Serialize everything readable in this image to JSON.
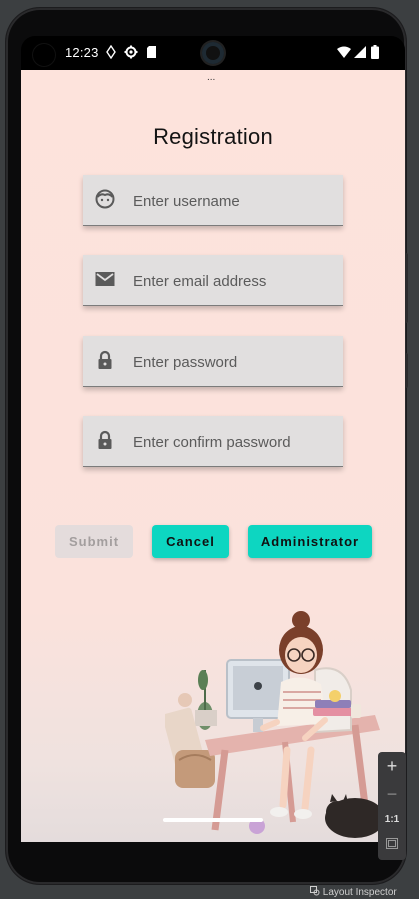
{
  "status_bar": {
    "time": "12:23"
  },
  "app": {
    "overflow_dots": "...",
    "title": "Registration",
    "fields": [
      {
        "placeholder": "Enter username",
        "icon": "face-icon"
      },
      {
        "placeholder": "Enter email address",
        "icon": "mail-icon"
      },
      {
        "placeholder": "Enter password",
        "icon": "lock-icon"
      },
      {
        "placeholder": "Enter confirm password",
        "icon": "lock-icon"
      }
    ],
    "buttons": {
      "submit": "Submit",
      "cancel": "Cancel",
      "administrator": "Administrator"
    },
    "colors": {
      "background": "#fde3dc",
      "field_fill": "#e1dfdf",
      "accent": "#0dd6c1",
      "disabled_button": "#e4dcdc"
    }
  },
  "ide": {
    "zoom_in": "+",
    "zoom_out": "−",
    "zoom_actual": "1:1",
    "layout_inspector": "Layout Inspector"
  }
}
